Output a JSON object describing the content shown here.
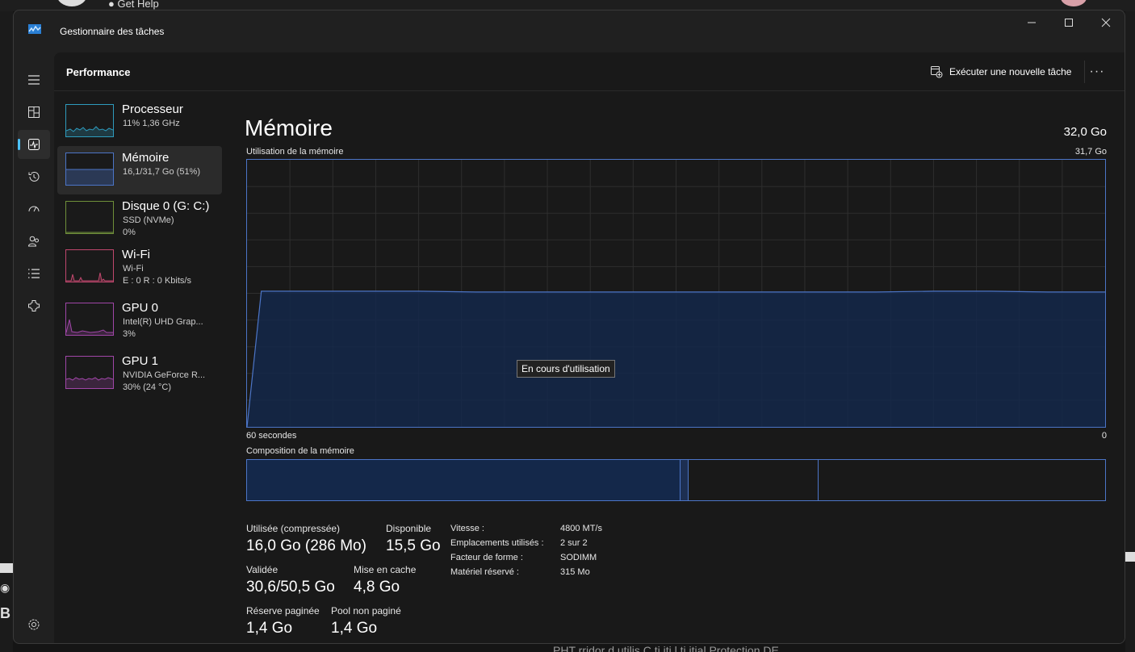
{
  "background": {
    "top_text": "Get Help",
    "bottom_text": "PHT   rridor  d utilis    C   ti   iti  l    ti    itial    Protection DE"
  },
  "window": {
    "title": "Gestionnaire des tâches",
    "controls": {
      "minimize": "—",
      "maximize": "☐",
      "close": "✕"
    }
  },
  "nav": {
    "items": [
      {
        "name": "hamburger-icon"
      },
      {
        "name": "processes-icon"
      },
      {
        "name": "performance-icon",
        "active": true
      },
      {
        "name": "app-history-icon"
      },
      {
        "name": "startup-apps-icon"
      },
      {
        "name": "users-icon"
      },
      {
        "name": "details-icon"
      },
      {
        "name": "services-icon"
      }
    ],
    "settings": "settings-icon"
  },
  "header": {
    "title": "Performance",
    "run_task_label": "Exécuter une nouvelle tâche",
    "more_label": "···"
  },
  "sidebar": {
    "items": [
      {
        "name": "Processeur",
        "sub1": "11% 1,36 GHz",
        "sub2": "",
        "color": "#2e9bbd"
      },
      {
        "name": "Mémoire",
        "sub1": "16,1/31,7 Go (51%)",
        "sub2": "",
        "color": "#4c75c7",
        "active": true
      },
      {
        "name": "Disque 0 (G: C:)",
        "sub1": "SSD (NVMe)",
        "sub2": "0%",
        "color": "#6f8f3a"
      },
      {
        "name": "Wi-Fi",
        "sub1": "Wi-Fi",
        "sub2": "E : 0 R : 0 Kbits/s",
        "color": "#c0476d"
      },
      {
        "name": "GPU 0",
        "sub1": "Intel(R) UHD Grap...",
        "sub2": "3%",
        "color": "#a046a8"
      },
      {
        "name": "GPU 1",
        "sub1": "NVIDIA GeForce R...",
        "sub2": "30%  (24 °C)",
        "color": "#a046a8"
      }
    ]
  },
  "main": {
    "title": "Mémoire",
    "total": "32,0 Go",
    "usage_label": "Utilisation de la mémoire",
    "usage_max": "31,7 Go",
    "time_left": "60 secondes",
    "time_right": "0",
    "tooltip": "En cours d'utilisation",
    "composition_label": "Composition de la mémoire"
  },
  "stats": {
    "in_use": {
      "label": "Utilisée (compressée)",
      "value": "16,0 Go (286 Mo)"
    },
    "available": {
      "label": "Disponible",
      "value": "15,5 Go"
    },
    "committed": {
      "label": "Validée",
      "value": "30,6/50,5 Go"
    },
    "cached": {
      "label": "Mise en cache",
      "value": "4,8 Go"
    },
    "paged_pool": {
      "label": "Réserve paginée",
      "value": "1,4 Go"
    },
    "non_paged_pool": {
      "label": "Pool non paginé",
      "value": "1,4 Go"
    }
  },
  "details": [
    {
      "key": "Vitesse :",
      "value": "4800 MT/s"
    },
    {
      "key": "Emplacements utilisés :",
      "value": "2 sur 2"
    },
    {
      "key": "Facteur de forme :",
      "value": "SODIMM"
    },
    {
      "key": "Matériel réservé :",
      "value": "315 Mo"
    }
  ],
  "chart_data": {
    "type": "area",
    "title": "Utilisation de la mémoire",
    "x": [
      60,
      59,
      58,
      56,
      52,
      48,
      44,
      40,
      36,
      32,
      28,
      24,
      20,
      16,
      12,
      8,
      4,
      2,
      0
    ],
    "values": [
      0,
      16.1,
      16.1,
      16.1,
      16.1,
      16.1,
      16.0,
      16.0,
      16.0,
      16.0,
      16.0,
      16.0,
      16.0,
      16.0,
      16.1,
      16.1,
      16.0,
      16.0,
      16.0
    ],
    "ylim": [
      0,
      31.7
    ],
    "xlim": [
      60,
      0
    ],
    "xlabel_left": "60 secondes",
    "xlabel_right": "0",
    "grid": true,
    "composition": {
      "in_use": 16.0,
      "modified": 0.3,
      "standby": 4.8,
      "free": 10.9,
      "total": 31.7
    }
  }
}
